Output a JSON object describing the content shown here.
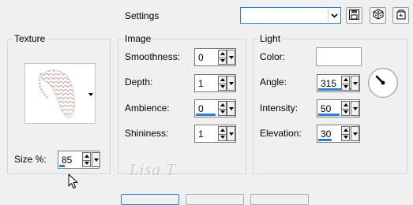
{
  "header": {
    "title": "Settings",
    "preset_value": ""
  },
  "texture": {
    "group_label": "Texture",
    "size_label": "Size %:",
    "size_value": "85"
  },
  "image": {
    "group_label": "Image",
    "smoothness_label": "Smoothness:",
    "smoothness_value": "0",
    "depth_label": "Depth:",
    "depth_value": "1",
    "ambience_label": "Ambience:",
    "ambience_value": "0",
    "shininess_label": "Shininess:",
    "shininess_value": "1"
  },
  "light": {
    "group_label": "Light",
    "color_label": "Color:",
    "color_value": "#ffffff",
    "angle_label": "Angle:",
    "angle_value": "315",
    "intensity_label": "Intensity:",
    "intensity_value": "50",
    "elevation_label": "Elevation:",
    "elevation_value": "30"
  },
  "watermark": "Lisa T",
  "colors": {
    "accent": "#2f7fd1",
    "focus_border": "#1f7fd6",
    "background": "#f0f0f0"
  },
  "icons": {
    "save": "save-icon",
    "randomize": "randomize-dice-icon",
    "reset": "reset-icon"
  }
}
